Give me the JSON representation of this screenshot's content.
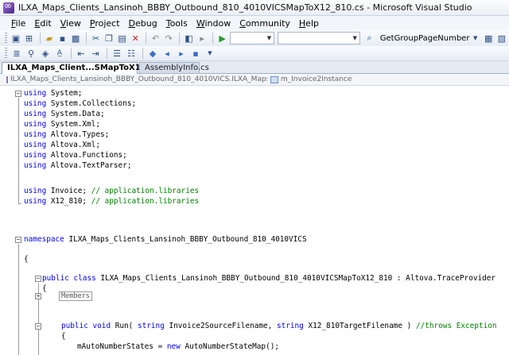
{
  "window": {
    "title": "ILXA_Maps_Clients_Lansinoh_BBBY_Outbound_810_4010VICSMapToX12_810.cs - Microsoft Visual Studio"
  },
  "menu": {
    "items": [
      "File",
      "Edit",
      "View",
      "Project",
      "Debug",
      "Tools",
      "Window",
      "Community",
      "Help"
    ]
  },
  "toolbar": {
    "find_value": "GetGroupPageNumber"
  },
  "tabs": [
    {
      "label": "ILXA_Maps_Client...SMapToX12_810.cs",
      "active": true
    },
    {
      "label": "AssemblyInfo.cs",
      "active": false
    }
  ],
  "navbar": {
    "class_combo": "ILXA_Maps_Clients_Lansinoh_BBBY_Outbound_810_4010VICS.ILXA_Maps_Clien",
    "member_combo": "m_Invoice2Instance"
  },
  "code": {
    "using_lines": [
      {
        "kw": "using",
        "text": " System;",
        "comment": ""
      },
      {
        "kw": "using",
        "text": " System.Collections;",
        "comment": ""
      },
      {
        "kw": "using",
        "text": " System.Data;",
        "comment": ""
      },
      {
        "kw": "using",
        "text": " System.Xml;",
        "comment": ""
      },
      {
        "kw": "using",
        "text": " Altova.Types;",
        "comment": ""
      },
      {
        "kw": "using",
        "text": " Altova.Xml;",
        "comment": ""
      },
      {
        "kw": "using",
        "text": " Altova.Functions;",
        "comment": ""
      },
      {
        "kw": "using",
        "text": " Altova.TextParser;",
        "comment": ""
      },
      {
        "kw": "using",
        "text": " Invoice; ",
        "comment": "// application.libraries"
      },
      {
        "kw": "using",
        "text": " X12_810; ",
        "comment": "// application.libraries"
      }
    ],
    "namespace_kw": "namespace",
    "namespace_name": " ILXA_Maps_Clients_Lansinoh_BBBY_Outbound_810_4010VICS",
    "open_brace": "{",
    "class_kw": "public class",
    "class_rest": " ILXA_Maps_Clients_Lansinoh_BBBY_Outbound_810_4010VICSMapToX12_810 : Altova.TraceProvider",
    "collapsed_label": "Members",
    "run_kw1": "public void",
    "run_mid1": " Run( ",
    "run_kw2": "string",
    "run_mid2": " Invoice2SourceFilename, ",
    "run_kw3": "string",
    "run_mid3": " X12_810TargetFilename ) ",
    "run_comment": "//throws Exception",
    "auto_pre": "mAutoNumberStates = ",
    "auto_kw": "new",
    "auto_post": " AutoNumberStateMap();"
  }
}
